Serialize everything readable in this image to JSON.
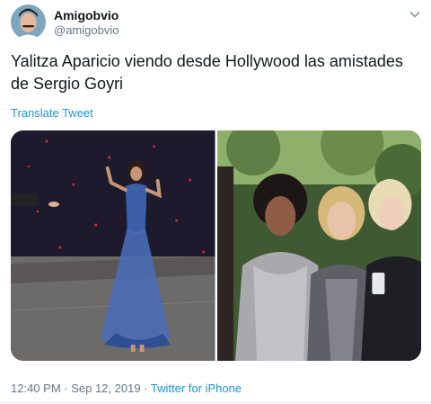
{
  "author": {
    "display_name": "Amigobvio",
    "handle": "@amigobvio"
  },
  "tweet": {
    "text": "Yalitza Aparicio viendo desde Hollywood las amistades de Sergio Goyri",
    "translate_label": "Translate Tweet"
  },
  "footer": {
    "timestamp": "12:40 PM · Sep 12, 2019",
    "separator": " · ",
    "source": "Twitter for iPhone"
  },
  "icons": {
    "menu": "chevron-down-icon",
    "avatar": "avatar"
  },
  "colors": {
    "link": "#1b95e0",
    "secondary_text": "#657786",
    "primary_text": "#14171a"
  }
}
